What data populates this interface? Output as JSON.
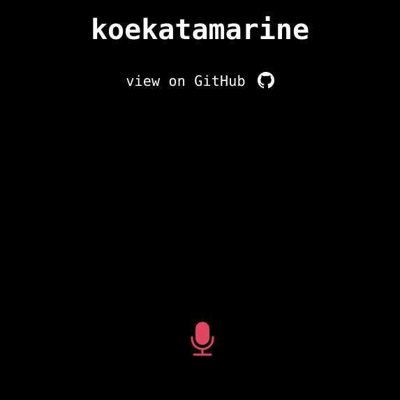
{
  "app": {
    "title": "koekatamarine"
  },
  "github_link": {
    "label": "view on GitHub",
    "icon": "github-icon"
  },
  "mic": {
    "icon": "microphone-icon",
    "color": "#e0445e"
  },
  "colors": {
    "background": "#000000",
    "text": "#ffffff",
    "accent": "#e0445e"
  }
}
